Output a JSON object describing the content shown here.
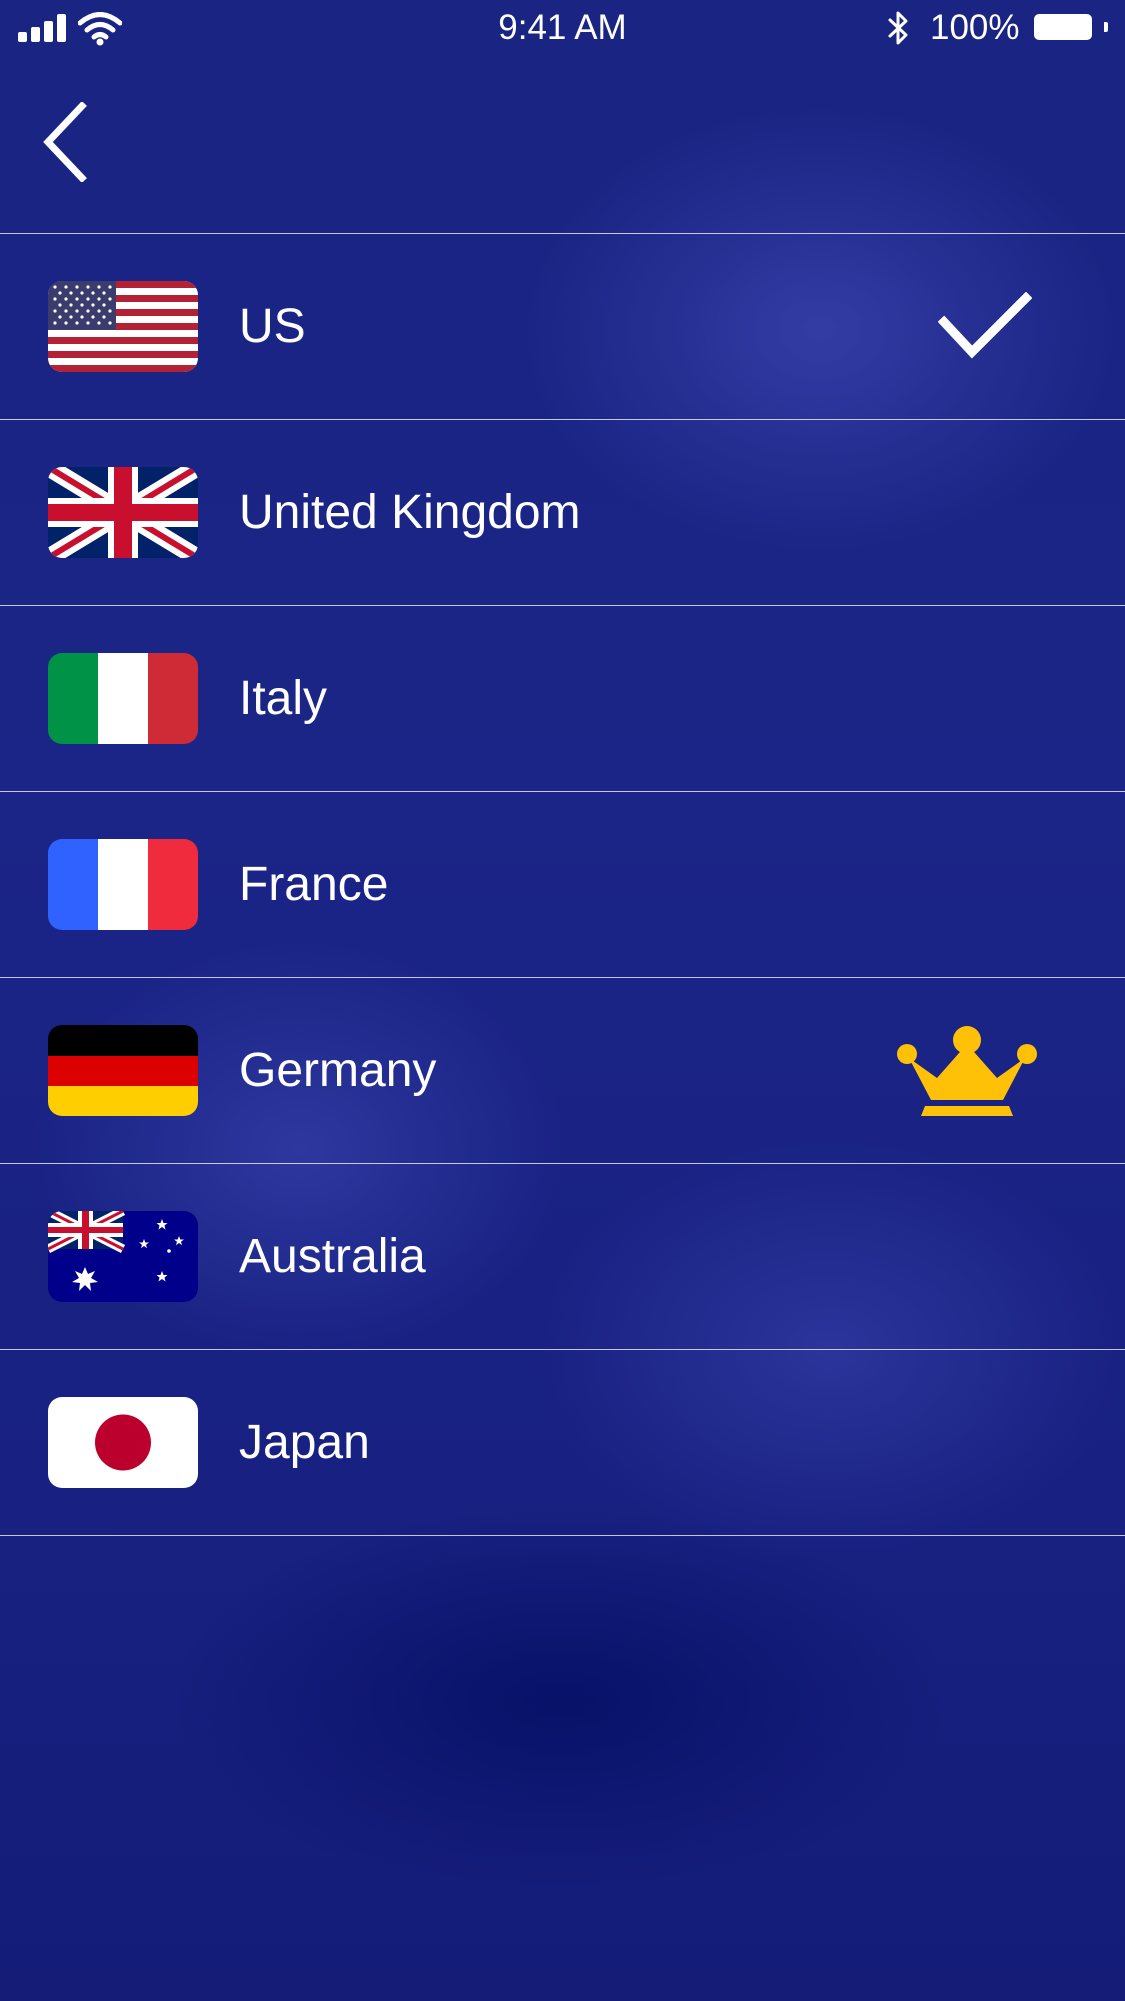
{
  "status_bar": {
    "time": "9:41 AM",
    "battery_percent": "100%",
    "icons": [
      "signal-icon",
      "wifi-icon",
      "bluetooth-icon",
      "battery-icon"
    ]
  },
  "header": {
    "back_icon": "chevron-left-icon"
  },
  "countries": [
    {
      "name": "US",
      "flag": "us-flag-icon",
      "selected": true,
      "badge": "checkmark-icon"
    },
    {
      "name": "United Kingdom",
      "flag": "uk-flag-icon",
      "selected": false
    },
    {
      "name": "Italy",
      "flag": "italy-flag-icon",
      "selected": false
    },
    {
      "name": "France",
      "flag": "france-flag-icon",
      "selected": false
    },
    {
      "name": "Germany",
      "flag": "germany-flag-icon",
      "selected": false,
      "badge": "crown-icon"
    },
    {
      "name": "Australia",
      "flag": "australia-flag-icon",
      "selected": false
    },
    {
      "name": "Japan",
      "flag": "japan-flag-icon",
      "selected": false
    }
  ],
  "colors": {
    "background": "#1b2587",
    "crown": "#ffc107",
    "divider": "#ffffff"
  }
}
